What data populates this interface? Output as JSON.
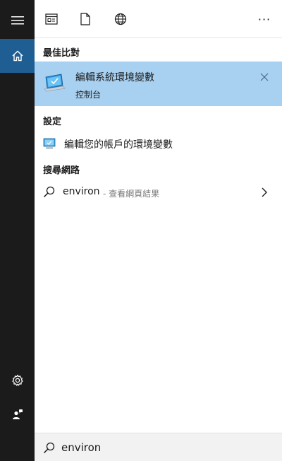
{
  "rail": {
    "menu_icon": "hamburger-menu-icon",
    "home_icon": "home-icon",
    "settings_icon": "gear-icon",
    "feedback_icon": "feedback-person-icon"
  },
  "toolbar": {
    "apps_icon": "app-window-icon",
    "documents_icon": "document-icon",
    "web_icon": "globe-icon",
    "more_label": "···"
  },
  "best_match": {
    "heading": "最佳比對",
    "title": "編輯系統環境變數",
    "subtitle": "控制台",
    "icon": "control-panel-monitor-icon"
  },
  "settings": {
    "heading": "設定",
    "items": [
      {
        "label": "編輯您的帳戶的環境變數",
        "icon": "settings-monitor-icon"
      }
    ]
  },
  "web": {
    "heading": "搜尋網路",
    "items": [
      {
        "query": "environ",
        "suffix": "- 查看網頁結果",
        "icon": "search-icon"
      }
    ]
  },
  "search": {
    "value": "environ",
    "icon": "search-icon"
  },
  "colors": {
    "rail_bg": "#1b1b1b",
    "home_active": "#1f5e93",
    "highlight": "#a8d0f0",
    "searchbar_bg": "#f2f2f2"
  }
}
